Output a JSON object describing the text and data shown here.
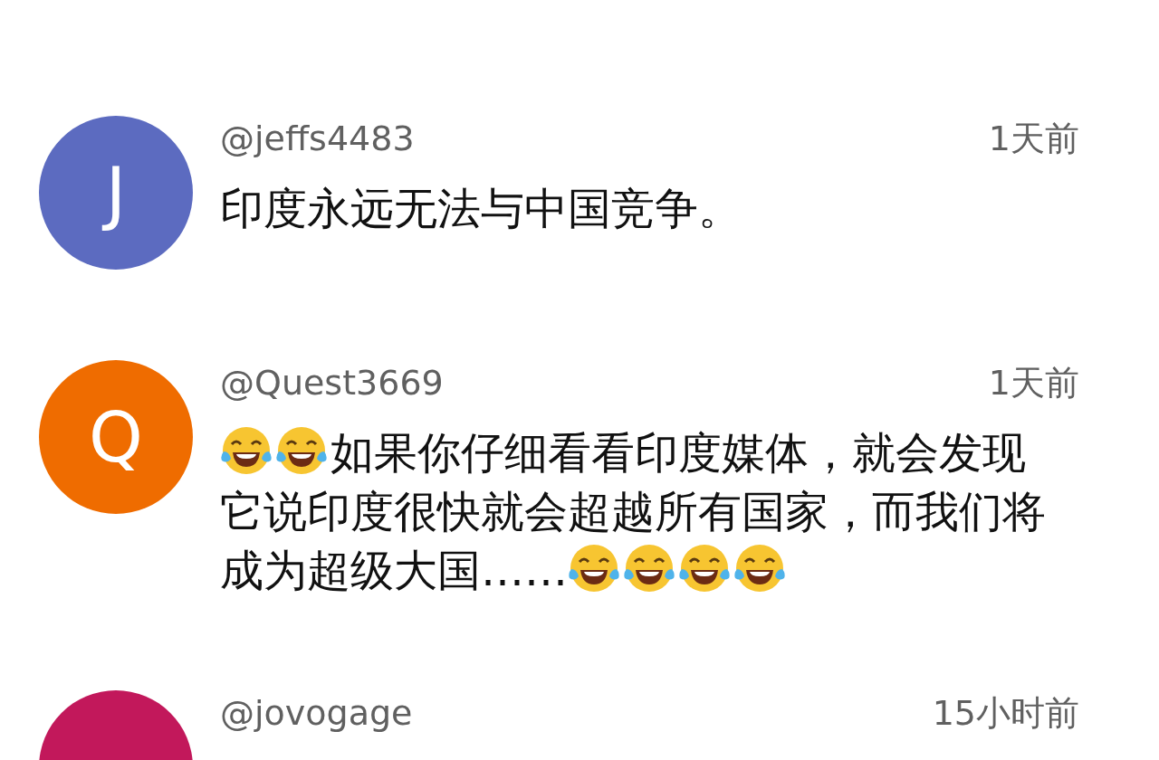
{
  "comments": [
    {
      "avatar": {
        "letter": "J",
        "color": "#5c6bc0"
      },
      "username": "@jeffs4483",
      "time": "1天前",
      "body": [
        {
          "kind": "text",
          "text": "印度永远无法与中国竞争。"
        }
      ]
    },
    {
      "avatar": {
        "letter": "Q",
        "color": "#ef6c00"
      },
      "username": "@Quest3669",
      "time": "1天前",
      "body": [
        {
          "kind": "emoji"
        },
        {
          "kind": "emoji"
        },
        {
          "kind": "text",
          "text": "如果你仔细看看印度媒体，就会发现"
        },
        {
          "kind": "text",
          "text": "它说印度很快就会超越所有国家，而我们将"
        },
        {
          "kind": "text",
          "text": "成为超级大国……"
        },
        {
          "kind": "emoji"
        },
        {
          "kind": "emoji"
        },
        {
          "kind": "emoji"
        },
        {
          "kind": "emoji"
        }
      ]
    },
    {
      "avatar": {
        "color": "#c2185b"
      },
      "username": "@jovogage",
      "time": "15小时前"
    }
  ]
}
